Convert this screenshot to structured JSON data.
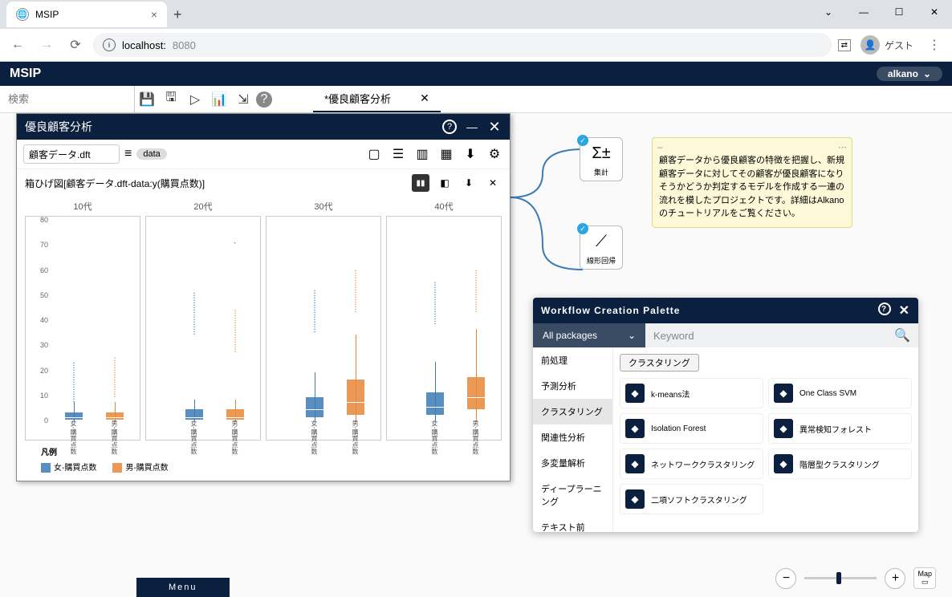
{
  "browser": {
    "tab_title": "MSIP",
    "new_tab": "+",
    "tab_close": "×",
    "url_host": "localhost:",
    "url_port": "8080",
    "guest_label": "ゲスト",
    "window": {
      "min": "—",
      "max": "☐",
      "close": "✕",
      "chev": "⌄"
    }
  },
  "app": {
    "title": "MSIP",
    "pill": "alkano",
    "search_placeholder": "検索",
    "file_tab": "*優良顧客分析",
    "menu_label": "Menu"
  },
  "viz_panel": {
    "title": "優良顧客分析",
    "filename": "顧客データ.dft",
    "badge": "data",
    "chart_title": "箱ひげ図[顧客データ.dft-data:y(購買点数)]",
    "legend_title": "凡例",
    "legend": {
      "f": "女-購買点数",
      "m": "男-購買点数"
    }
  },
  "chart_data": {
    "type": "boxplot",
    "title": "箱ひげ図[顧客データ.dft-data:y(購買点数)]",
    "ylabel": "購買点数",
    "ylim": [
      0,
      80
    ],
    "yticks": [
      0,
      10,
      20,
      30,
      40,
      50,
      60,
      70,
      80
    ],
    "facets": [
      "10代",
      "20代",
      "30代",
      "40代"
    ],
    "series": [
      {
        "name": "女-購買点数",
        "color": "#3b7bb5"
      },
      {
        "name": "男-購買点数",
        "color": "#e8873a"
      }
    ],
    "xlabel_f": "女-購買点数",
    "xlabel_m": "男-購買点数",
    "data": {
      "10代": {
        "女": {
          "q1": 1,
          "median": 2,
          "q3": 4,
          "whisker_low": 0,
          "whisker_high": 8,
          "outlier_max": 23
        },
        "男": {
          "q1": 1,
          "median": 2,
          "q3": 4,
          "whisker_low": 0,
          "whisker_high": 8,
          "outlier_max": 25
        }
      },
      "20代": {
        "女": {
          "q1": 1,
          "median": 2,
          "q3": 5,
          "whisker_low": 0,
          "whisker_high": 9,
          "outlier_max": 51
        },
        "男": {
          "q1": 1,
          "median": 2,
          "q3": 5,
          "whisker_low": 0,
          "whisker_high": 9,
          "outlier_max": 44
        },
        "男_special_outlier": 72
      },
      "30代": {
        "女": {
          "q1": 2,
          "median": 5,
          "q3": 10,
          "whisker_low": 0,
          "whisker_high": 20,
          "outlier_max": 52
        },
        "男": {
          "q1": 3,
          "median": 8,
          "q3": 17,
          "whisker_low": 0,
          "whisker_high": 35,
          "outlier_max": 60
        }
      },
      "40代": {
        "女": {
          "q1": 3,
          "median": 6,
          "q3": 12,
          "whisker_low": 0,
          "whisker_high": 24,
          "outlier_max": 55
        },
        "男": {
          "q1": 5,
          "median": 10,
          "q3": 18,
          "whisker_low": 0,
          "whisker_high": 37,
          "outlier_max": 60
        }
      }
    }
  },
  "wf_nodes": {
    "agg": "集計",
    "lr": "線形回帰"
  },
  "note": "顧客データから優良顧客の特徴を把握し、新規顧客データに対してその顧客が優良顧客になりそうかどうか判定するモデルを作成する一連の流れを模したプロジェクトです。詳細はAlkanoのチュートリアルをご覧ください。",
  "palette": {
    "title": "Workflow Creation Palette",
    "package": "All packages",
    "keyword_placeholder": "Keyword",
    "categories": [
      "前処理",
      "予測分析",
      "クラスタリング",
      "関連性分析",
      "多変量解析",
      "ディープラーニング",
      "テキスト前"
    ],
    "active_category": "クラスタリング",
    "section_title": "クラスタリング",
    "ops": [
      "k-means法",
      "One Class SVM",
      "Isolation Forest",
      "異常検知フォレスト",
      "ネットワーククラスタリング",
      "階層型クラスタリング",
      "二項ソフトクラスタリング"
    ]
  },
  "zoom": {
    "map": "Map"
  }
}
